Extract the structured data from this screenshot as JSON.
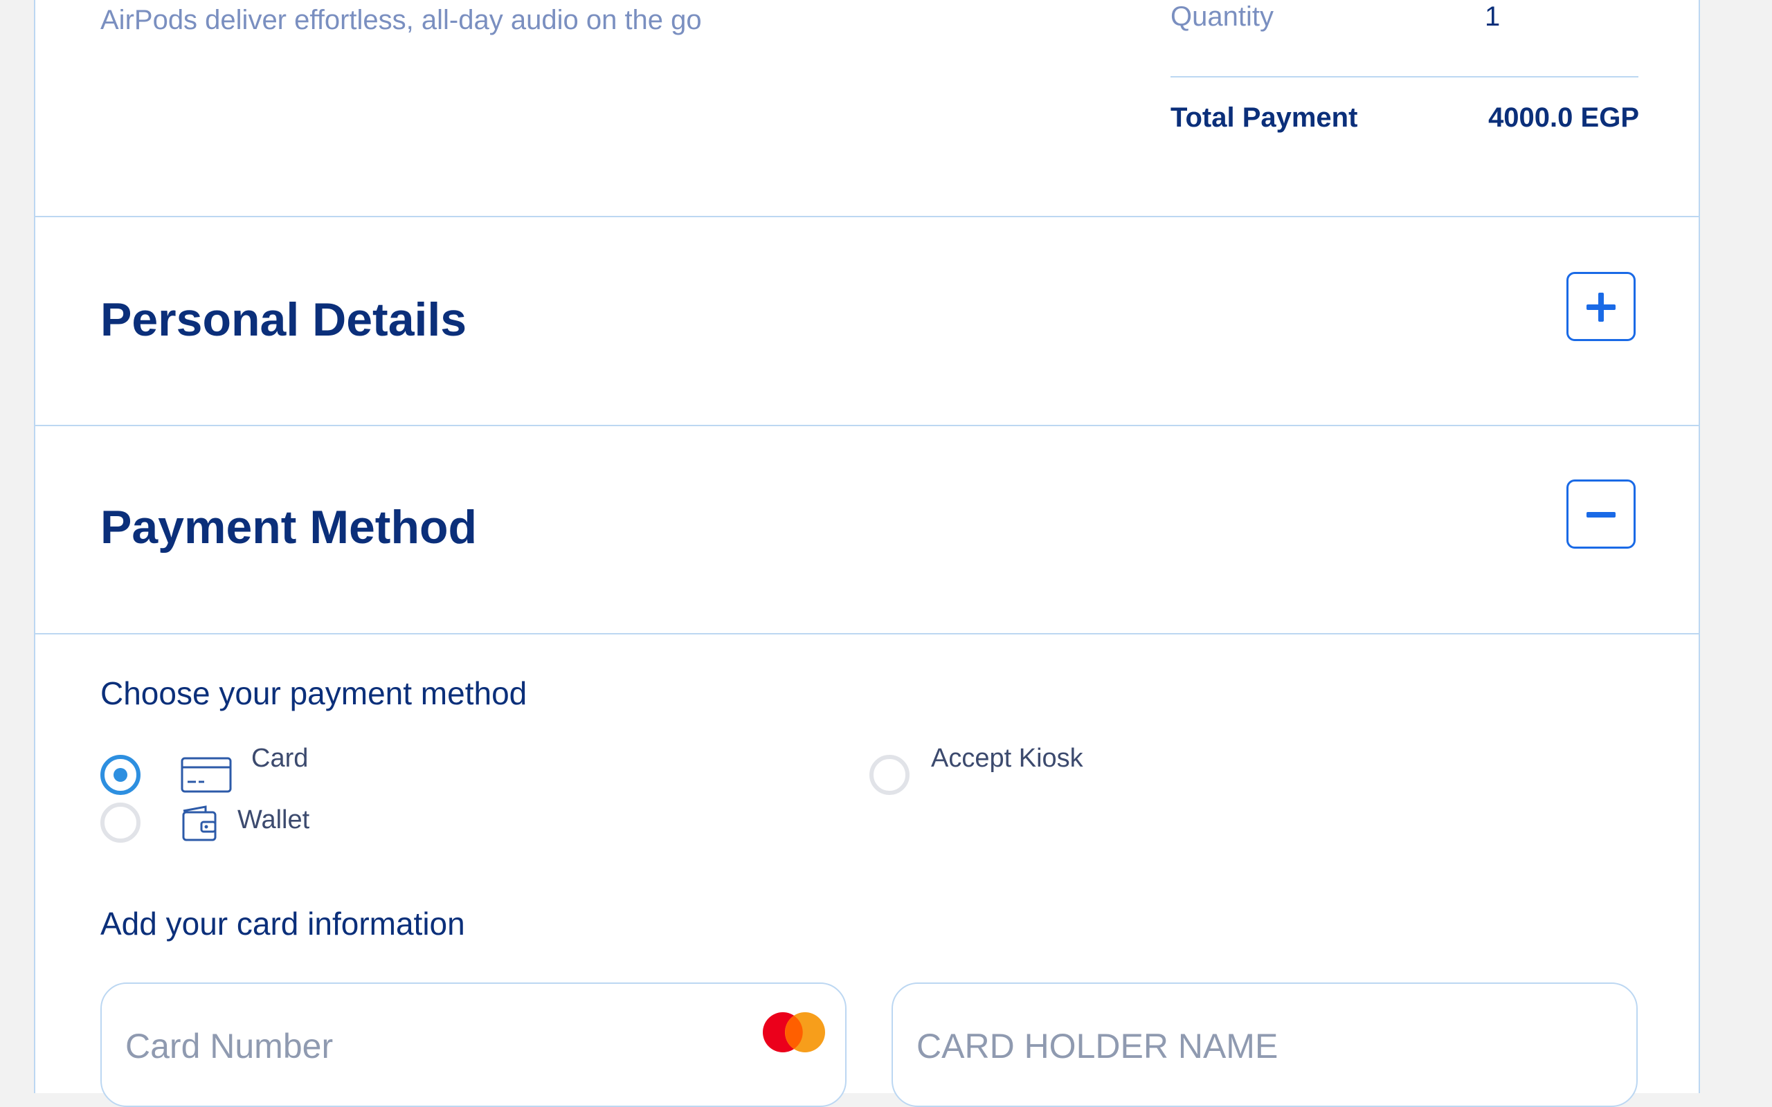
{
  "order_summary": {
    "description": "AirPods deliver effortless, all-day audio on the go",
    "quantity_label": "Quantity",
    "quantity_value": "1",
    "total_label": "Total Payment",
    "total_value": "4000.0 EGP"
  },
  "personal_details": {
    "title": "Personal Details",
    "toggle_state": "collapsed"
  },
  "payment_method": {
    "title": "Payment Method",
    "toggle_state": "expanded",
    "choose_label": "Choose your payment method",
    "options": [
      {
        "label": "Card",
        "icon": "credit-card-icon",
        "selected": true
      },
      {
        "label": "Accept Kiosk",
        "icon": "",
        "selected": false
      },
      {
        "label": "Wallet",
        "icon": "wallet-icon",
        "selected": false
      }
    ],
    "card_info_label": "Add your card information",
    "card_number_placeholder": "Card Number",
    "card_holder_placeholder": "CARD HOLDER NAME"
  },
  "colors": {
    "primary_text": "#0b2f7a",
    "accent": "#1a6ae6",
    "radio_selected": "#2d8fe0",
    "border": "#bcd7f2"
  }
}
